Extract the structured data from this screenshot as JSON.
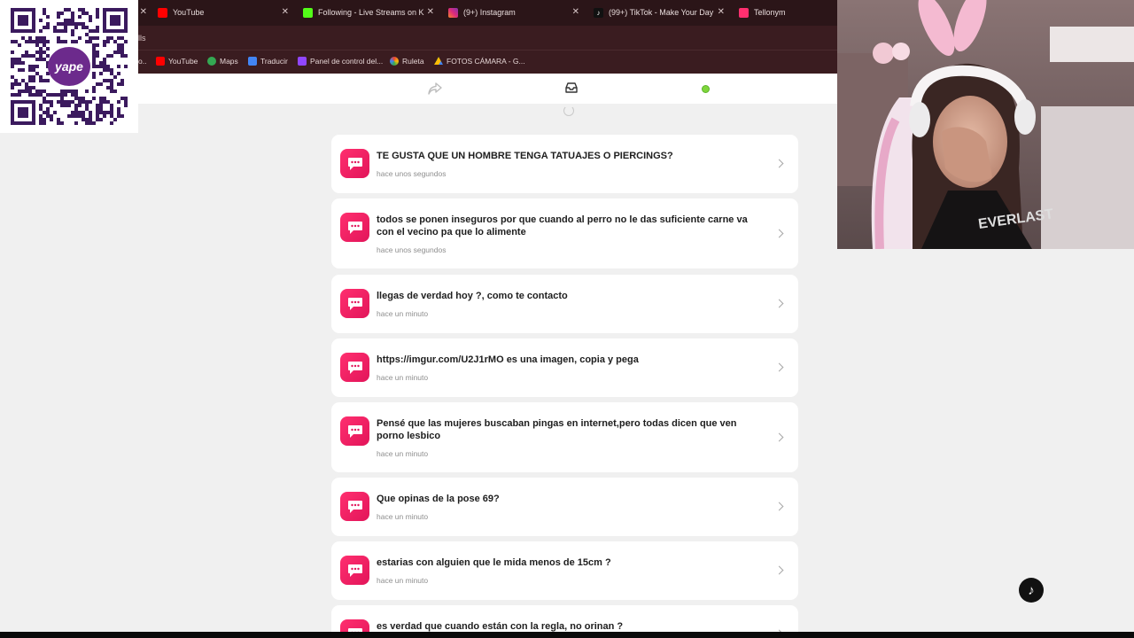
{
  "tabs": [
    {
      "title": "YouTube",
      "favicon_color": "#ff0000"
    },
    {
      "title": "Following - Live Streams on Kick",
      "favicon_color": "#53fc18"
    },
    {
      "title": "(9+) Instagram",
      "favicon_color": "#e1306c"
    },
    {
      "title": "(99+) TikTok - Make Your Day",
      "favicon_color": "#111111"
    },
    {
      "title": "Tellonym",
      "favicon_color": "#ff2f6f"
    }
  ],
  "address_fragment": "lls",
  "bookmarks": [
    {
      "label": "YouTube",
      "icon": "youtube-icon"
    },
    {
      "label": "Maps",
      "icon": "maps-icon"
    },
    {
      "label": "Traducir",
      "icon": "translate-icon"
    },
    {
      "label": "Panel de control del...",
      "icon": "twitch-icon"
    },
    {
      "label": "Ruleta",
      "icon": "wheel-icon"
    },
    {
      "label": "FOTOS CÁMARA - G...",
      "icon": "drive-icon"
    }
  ],
  "overlay": {
    "qr_brand": "yape"
  },
  "questions": [
    {
      "text": "TE GUSTA QUE UN HOMBRE TENGA TATUAJES O PIERCINGS?",
      "time": "hace unos segundos"
    },
    {
      "text": "todos se ponen inseguros por que cuando al perro no le das suficiente carne va con el vecino pa que lo alimente",
      "time": "hace unos segundos"
    },
    {
      "text": "llegas de verdad hoy ?, como te contacto",
      "time": "hace un minuto"
    },
    {
      "text": "https://imgur.com/U2J1rMO  es una imagen, copia y pega",
      "time": "hace un minuto"
    },
    {
      "text": "Pensé que las mujeres buscaban pingas en internet,pero todas dicen que ven porno lesbico",
      "time": "hace un minuto"
    },
    {
      "text": "Que opinas de la pose 69?",
      "time": "hace un minuto"
    },
    {
      "text": "estarias con alguien que le mida menos de 15cm ?",
      "time": "hace un minuto"
    },
    {
      "text": "es verdad que cuando están con la regla, no orinan ?",
      "time": ""
    }
  ],
  "colors": {
    "accent": "#ff2f6f",
    "online": "#7fd63b",
    "chrome_bg": "#2b1518"
  }
}
